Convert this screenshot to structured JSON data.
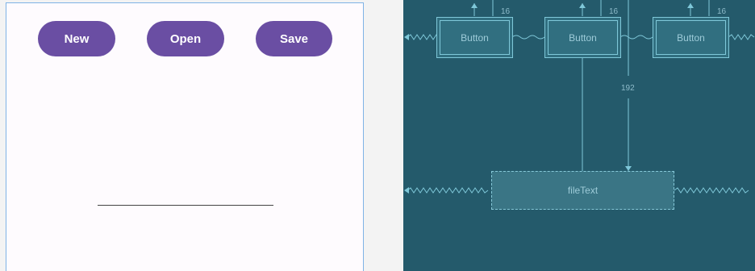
{
  "design": {
    "buttons": [
      {
        "label": "New"
      },
      {
        "label": "Open"
      },
      {
        "label": "Save"
      }
    ],
    "edit_text": {
      "value": ""
    }
  },
  "blueprint": {
    "buttons": [
      {
        "label": "Button",
        "margin": "16"
      },
      {
        "label": "Button",
        "margin": "16"
      },
      {
        "label": "Button",
        "margin": "16"
      }
    ],
    "file_text": {
      "label": "fileText"
    },
    "vertical_margin": "192"
  },
  "colors": {
    "button": "#6a4ea3",
    "blueprint_bg": "#245a6b",
    "blueprint_line": "#7fc8d9",
    "design_border": "#7fb3e6"
  }
}
